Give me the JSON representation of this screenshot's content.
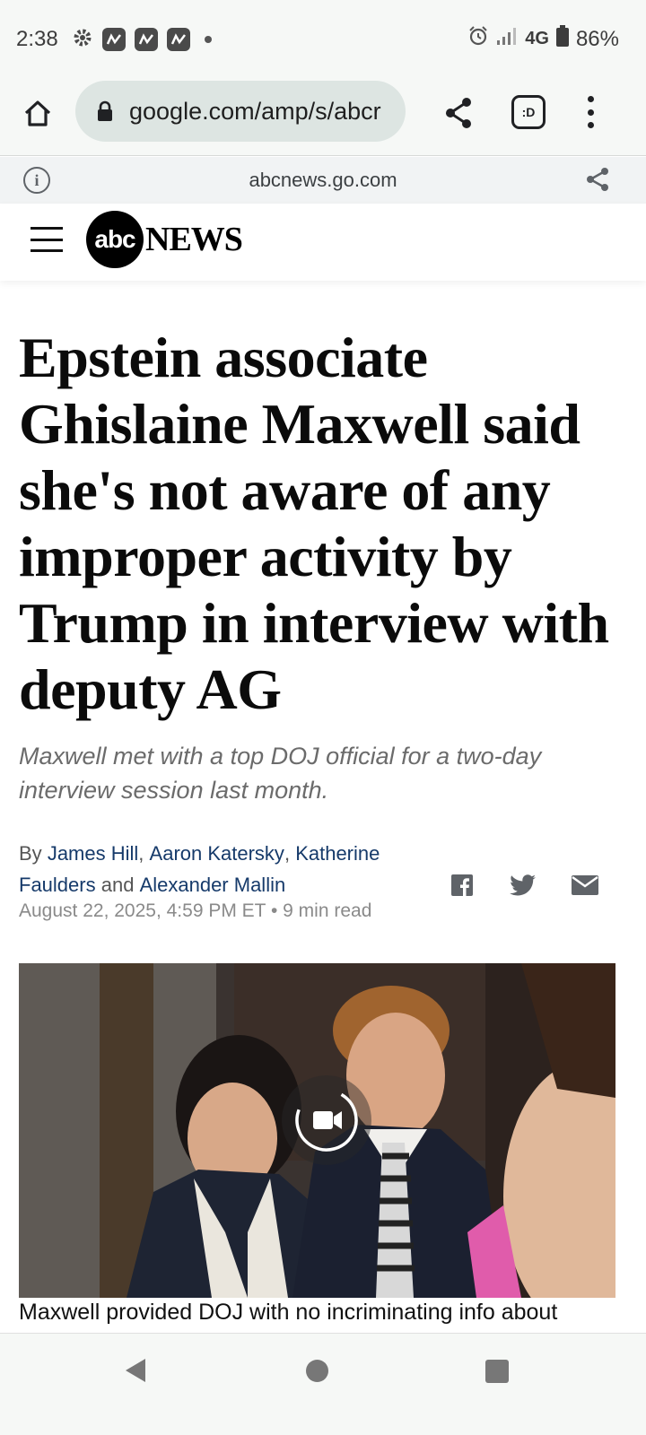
{
  "status_bar": {
    "time": "2:38",
    "network": "4G",
    "battery": "86%",
    "icons": [
      "gear-icon",
      "app-notification-icon",
      "app-notification-icon",
      "app-notification-icon",
      "dot-icon",
      "alarm-icon",
      "signal-icon",
      "battery-icon"
    ]
  },
  "browser": {
    "url": "google.com/amp/s/abcr",
    "tab_switcher_label": ":D",
    "amp_domain": "abcnews.go.com"
  },
  "site": {
    "logo_mark": "abc",
    "logo_word": "NEWS"
  },
  "article": {
    "headline": "Epstein associate Ghislaine Maxwell said she's not aware of any improper activity by Trump in interview with deputy AG",
    "subhead": "Maxwell met with a top DOJ official for a two-day interview session last month.",
    "by_prefix": "By",
    "authors": [
      "James Hill",
      "Aaron Katersky",
      "Katherine Faulders",
      "Alexander Mallin"
    ],
    "comma": ",",
    "and_word": "and",
    "date": "August 22, 2025, 4:59 PM ET",
    "read_time": "• 9 min read",
    "caption": "Maxwell provided DOJ with no incriminating info about"
  },
  "colors": {
    "link": "#163a6a",
    "chrome_bg": "#f6f8f6",
    "url_pill": "#dde5e2"
  }
}
